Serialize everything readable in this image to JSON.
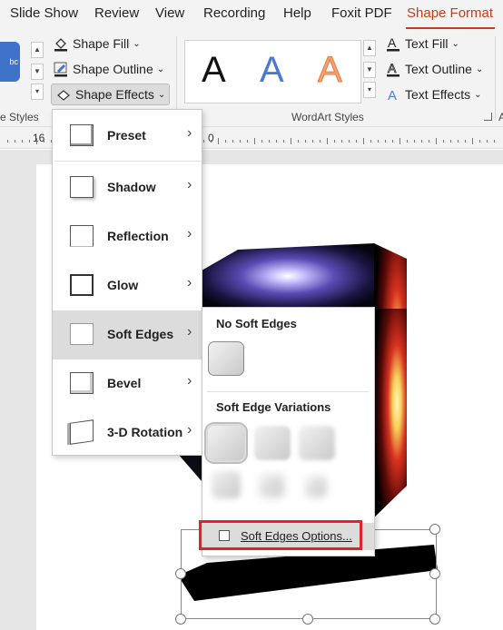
{
  "menubar": {
    "tabs": [
      {
        "label": "Slide Show",
        "active": false
      },
      {
        "label": "Review",
        "active": false
      },
      {
        "label": "View",
        "active": false
      },
      {
        "label": "Recording",
        "active": false
      },
      {
        "label": "Help",
        "active": false
      },
      {
        "label": "Foxit PDF",
        "active": false
      },
      {
        "label": "Shape Format",
        "active": true
      }
    ]
  },
  "ribbon": {
    "style_swatch_text": "bc",
    "shape_fill": "Shape Fill",
    "shape_outline": "Shape Outline",
    "shape_effects": "Shape Effects",
    "group_shape_styles": "e Styles",
    "wordart_letters": [
      "A",
      "A",
      "A"
    ],
    "text_fill": "Text Fill",
    "text_outline": "Text Outline",
    "text_effects": "Text Effects",
    "group_wordart": "WordArt Styles",
    "group_next": "A"
  },
  "ruler": {
    "left_number": "16",
    "right_number": "0"
  },
  "shape_effects_menu": {
    "items": [
      {
        "label": "Preset",
        "mnemonic": "P"
      },
      {
        "label": "Shadow",
        "mnemonic": "S"
      },
      {
        "label": "Reflection",
        "mnemonic": "R"
      },
      {
        "label": "Glow",
        "mnemonic": "G"
      },
      {
        "label": "Soft Edges",
        "mnemonic": "E",
        "highlighted": true
      },
      {
        "label": "Bevel",
        "mnemonic": "B"
      },
      {
        "label": "3-D Rotation",
        "mnemonic": "D"
      }
    ]
  },
  "soft_edges_submenu": {
    "no_soft_edges_heading": "No Soft Edges",
    "variations_heading": "Soft Edge Variations",
    "options_label": "Soft Edges Options..."
  },
  "colors": {
    "accent": "#c43e1c",
    "highlight_box": "#e0222b"
  }
}
